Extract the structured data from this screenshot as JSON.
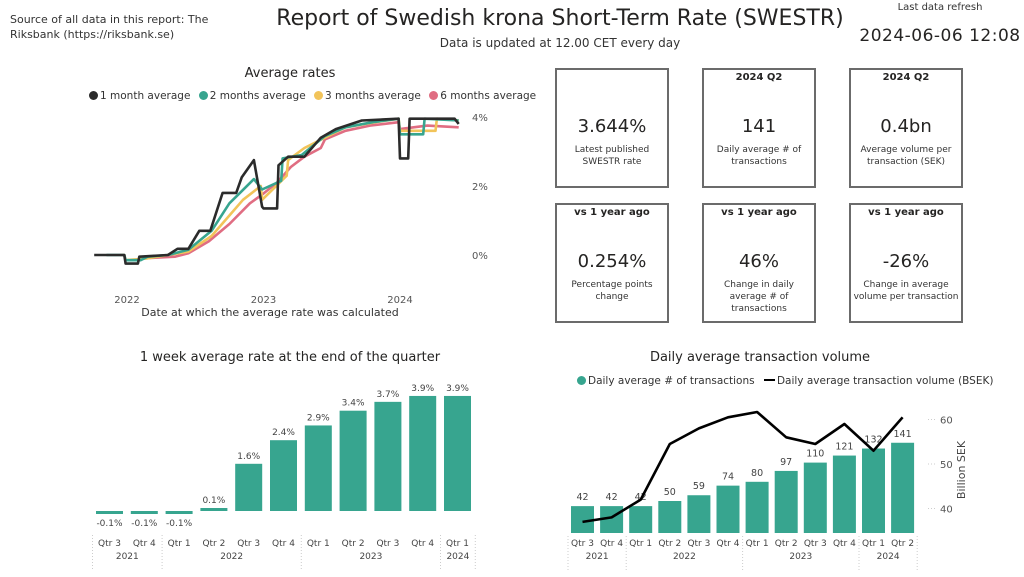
{
  "header": {
    "source_text": "Source of all data in this report: The Riksbank (https://riksbank.se)",
    "title": "Report of Swedish krona Short-Term Rate (SWESTR)",
    "subtitle": "Data is updated at 12.00 CET every day",
    "refresh_label": "Last data refresh",
    "refresh_value": "2024-06-06 12:08"
  },
  "cards": [
    {
      "head": "",
      "value": "3.644%",
      "label": "Latest published SWESTR rate"
    },
    {
      "head": "2024 Q2",
      "value": "141",
      "label": "Daily average # of transactions"
    },
    {
      "head": "2024 Q2",
      "value": "0.4bn",
      "label": "Average volume per transaction (SEK)"
    },
    {
      "head": "vs 1 year ago",
      "value": "0.254%",
      "label": "Percentage points change"
    },
    {
      "head": "vs 1 year ago",
      "value": "46%",
      "label": "Change in daily average # of transactions"
    },
    {
      "head": "vs 1 year ago",
      "value": "-26%",
      "label": "Change in average volume per transaction"
    }
  ],
  "colors": {
    "teal": "#37a58f",
    "black": "#2b2b2b",
    "yellow": "#f2c45a",
    "pink": "#e06d82"
  },
  "chart_data": [
    {
      "type": "line",
      "title": "Average rates",
      "xlabel": "Date at which the average rate was calculated",
      "ylabel": "",
      "x_ticks": [
        "2022",
        "2023",
        "2024"
      ],
      "y_ticks": [
        "0%",
        "2%",
        "4%"
      ],
      "ylim": [
        -0.6,
        4.1
      ],
      "xlim": [
        2021.74,
        2024.45
      ],
      "legend_position": "top",
      "series": [
        {
          "name": "1 month average",
          "color": "#2b2b2b",
          "x": [
            2021.76,
            2021.98,
            2021.99,
            2022.08,
            2022.09,
            2022.3,
            2022.37,
            2022.45,
            2022.53,
            2022.61,
            2022.7,
            2022.8,
            2022.84,
            2022.93,
            2022.99,
            2023.0,
            2023.1,
            2023.11,
            2023.18,
            2023.3,
            2023.42,
            2023.53,
            2023.72,
            2023.99,
            2024.0,
            2024.06,
            2024.07,
            2024.27,
            2024.4,
            2024.43
          ],
          "y": [
            0,
            0,
            -0.25,
            -0.25,
            -0.05,
            0,
            0.18,
            0.18,
            0.7,
            0.7,
            1.8,
            1.8,
            2.25,
            2.75,
            1.4,
            1.35,
            1.35,
            2.6,
            2.85,
            2.85,
            3.4,
            3.65,
            3.9,
            3.95,
            2.8,
            2.8,
            3.95,
            3.95,
            3.95,
            3.8
          ]
        },
        {
          "name": "2 months average",
          "color": "#37a58f",
          "x": [
            2021.85,
            2021.98,
            2021.99,
            2022.1,
            2022.15,
            2022.3,
            2022.45,
            2022.62,
            2022.75,
            2022.84,
            2022.93,
            2022.99,
            2023.13,
            2023.14,
            2023.28,
            2023.45,
            2023.6,
            2023.8,
            2023.99,
            2024.0,
            2024.07,
            2024.08,
            2024.17,
            2024.18,
            2024.43
          ],
          "y": [
            0,
            0,
            -0.15,
            -0.15,
            -0.05,
            0,
            0.15,
            0.7,
            1.5,
            1.85,
            2.2,
            1.9,
            2.15,
            2.8,
            2.9,
            3.45,
            3.7,
            3.85,
            3.95,
            3.5,
            3.5,
            3.5,
            3.5,
            3.95,
            3.9
          ]
        },
        {
          "name": "3 months average",
          "color": "#f2c45a",
          "x": [
            2021.95,
            2021.98,
            2021.99,
            2022.15,
            2022.3,
            2022.45,
            2022.62,
            2022.85,
            2022.98,
            2022.99,
            2023.17,
            2023.18,
            2023.3,
            2023.45,
            2023.6,
            2023.82,
            2023.99,
            2024.0,
            2024.26,
            2024.27,
            2024.43
          ],
          "y": [
            0,
            0,
            -0.15,
            -0.1,
            0,
            0.1,
            0.55,
            1.6,
            2.0,
            1.6,
            2.3,
            2.75,
            3.1,
            3.4,
            3.7,
            3.85,
            3.95,
            3.6,
            3.6,
            3.95,
            3.9
          ]
        },
        {
          "name": "6 months average",
          "color": "#e06d82",
          "x": [
            2022.1,
            2022.35,
            2022.45,
            2022.6,
            2022.75,
            2022.9,
            2022.99,
            2023.1,
            2023.2,
            2023.3,
            2023.42,
            2023.45,
            2023.6,
            2023.78,
            2023.99,
            2024.0,
            2024.2,
            2024.43
          ],
          "y": [
            -0.1,
            -0.05,
            0.05,
            0.4,
            0.9,
            1.5,
            1.75,
            2.1,
            2.55,
            2.85,
            3.1,
            3.35,
            3.6,
            3.75,
            3.85,
            3.65,
            3.75,
            3.7
          ]
        }
      ]
    },
    {
      "type": "bar",
      "title": "1 week average rate at the end of the quarter",
      "categories": [
        "Qtr 3",
        "Qtr 4",
        "Qtr 1",
        "Qtr 2",
        "Qtr 3",
        "Qtr 4",
        "Qtr 1",
        "Qtr 2",
        "Qtr 3",
        "Qtr 4",
        "Qtr 1"
      ],
      "category_groups": [
        {
          "label": "2021",
          "count": 2
        },
        {
          "label": "2022",
          "count": 4
        },
        {
          "label": "2023",
          "count": 4
        },
        {
          "label": "2024",
          "count": 1
        }
      ],
      "values": [
        -0.1,
        -0.1,
        -0.1,
        0.1,
        1.6,
        2.4,
        2.9,
        3.4,
        3.7,
        3.9,
        3.9
      ],
      "data_labels": [
        "-0.1%",
        "-0.1%",
        "-0.1%",
        "0.1%",
        "1.6%",
        "2.4%",
        "2.9%",
        "3.4%",
        "3.7%",
        "3.9%",
        "3.9%"
      ],
      "ylim": [
        -0.4,
        4.1
      ],
      "color": "#37a58f"
    },
    {
      "type": "bar",
      "title": "Daily average transaction volume",
      "legend_position": "top",
      "legend": [
        "Daily average # of transactions",
        "Daily average transaction volume (BSEK)"
      ],
      "categories": [
        "Qtr 3",
        "Qtr 4",
        "Qtr 1",
        "Qtr 2",
        "Qtr 3",
        "Qtr 4",
        "Qtr 1",
        "Qtr 2",
        "Qtr 3",
        "Qtr 4",
        "Qtr 1",
        "Qtr 2"
      ],
      "category_groups": [
        {
          "label": "2021",
          "count": 2
        },
        {
          "label": "2022",
          "count": 4
        },
        {
          "label": "2023",
          "count": 4
        },
        {
          "label": "2024",
          "count": 2
        }
      ],
      "series": [
        {
          "name": "Daily average # of transactions",
          "type": "bar",
          "color": "#37a58f",
          "values": [
            42,
            42,
            42,
            50,
            59,
            74,
            80,
            97,
            110,
            121,
            132,
            141
          ]
        },
        {
          "name": "Daily average transaction volume (BSEK)",
          "type": "line",
          "color": "#000000",
          "axis": "right",
          "values": [
            37,
            38,
            42,
            54.5,
            58,
            60.5,
            61.7,
            56,
            54.5,
            59,
            53,
            60.5
          ]
        }
      ],
      "bar_ylim": [
        0,
        148
      ],
      "y2label": "Billion SEK",
      "y2_ticks": [
        "40",
        "50",
        "60"
      ],
      "y2lim": [
        34.5,
        63.5
      ]
    }
  ]
}
